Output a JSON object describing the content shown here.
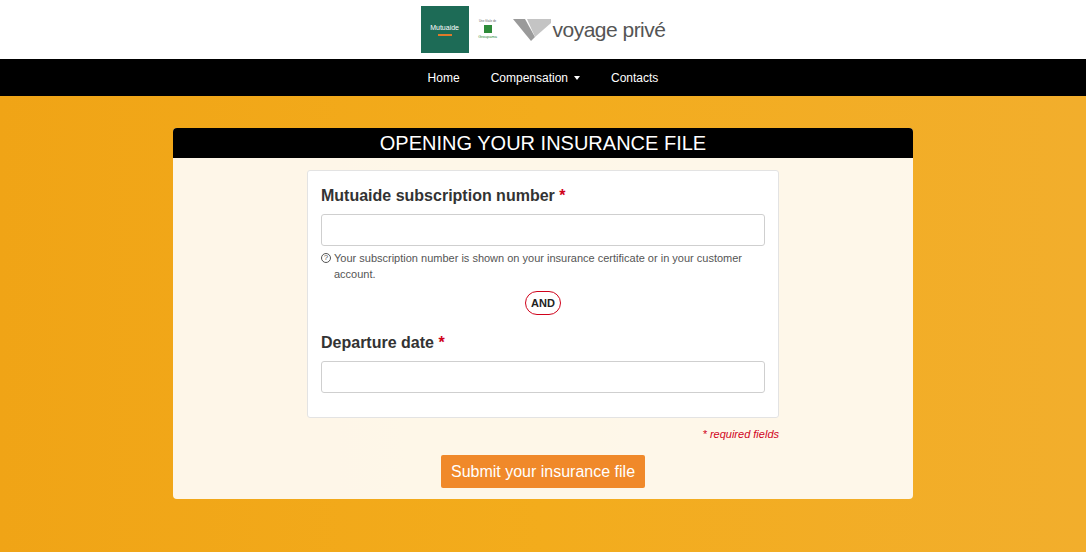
{
  "header": {
    "mutuaide": "Mutuaide",
    "groupama_caption": "Une filiale de",
    "groupama": "Groupama",
    "brand": "voyage privé"
  },
  "nav": [
    {
      "label": "Home",
      "dropdown": false
    },
    {
      "label": "Compensation",
      "dropdown": true
    },
    {
      "label": "Contacts",
      "dropdown": false
    }
  ],
  "form": {
    "title": "OPENING YOUR INSURANCE FILE",
    "fields": [
      {
        "label": "Mutuaide subscription number",
        "required_mark": "*",
        "help_icon": "?",
        "help": "Your subscription number is shown on your insurance certificate or in your customer account."
      },
      {
        "label": "Departure date",
        "required_mark": "*"
      }
    ],
    "separator": "AND",
    "required_note": "* required fields",
    "submit": "Submit your insurance file"
  }
}
